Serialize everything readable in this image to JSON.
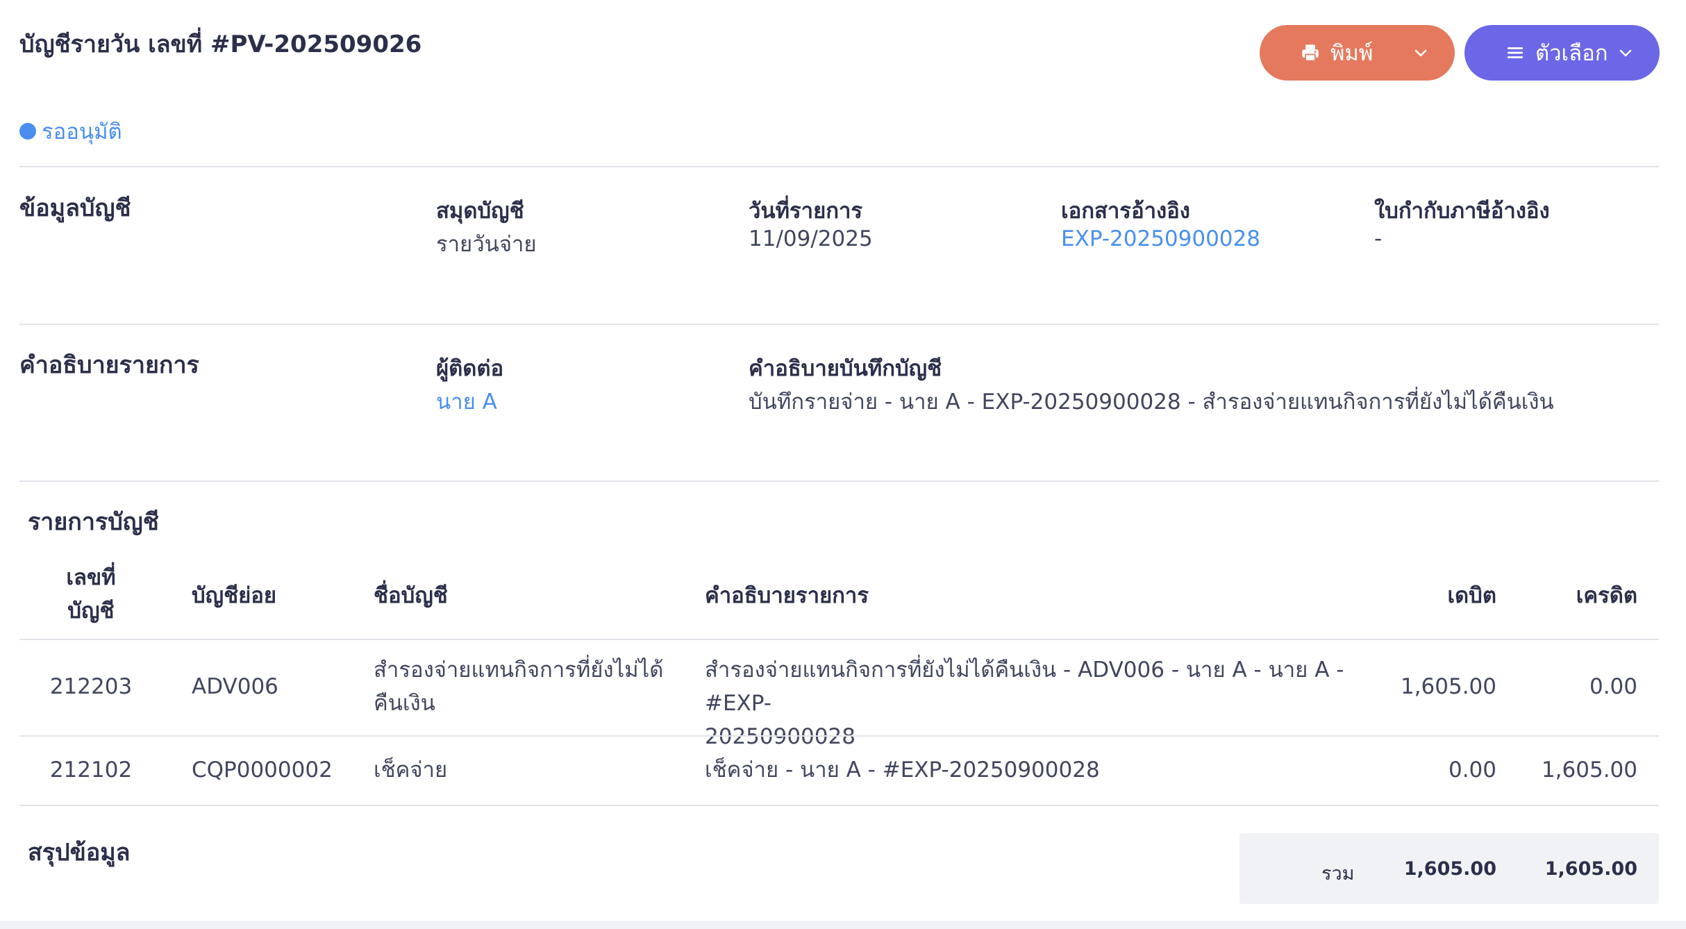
{
  "header": {
    "title": "บัญชีรายวัน เลขที่ #PV-202509026",
    "status": "รออนุมัติ",
    "print_button": "พิมพ์",
    "options_button": "ตัวเลือก"
  },
  "account_info": {
    "section_title": "ข้อมูลบัญชี",
    "book_label": "สมุดบัญชี",
    "book_value": "รายวันจ่าย",
    "date_label": "วันที่รายการ",
    "date_value": "11/09/2025",
    "ref_doc_label": "เอกสารอ้างอิง",
    "ref_doc_value": "EXP-20250900028",
    "tax_invoice_label": "ใบกำกับภาษีอ้างอิง",
    "tax_invoice_value": "-"
  },
  "description": {
    "section_title": "คำอธิบายรายการ",
    "contact_label": "ผู้ติดต่อ",
    "contact_value": "นาย A",
    "memo_label": "คำอธิบายบันทึกบัญชี",
    "memo_value": "บันทึกรายจ่าย - นาย A - EXP-20250900028 - สำรองจ่ายแทนกิจการที่ยังไม่ได้คืนเงิน"
  },
  "entries": {
    "section_title": "รายการบัญชี",
    "columns": {
      "account_no_line1": "เลขที่",
      "account_no_line2": "บัญชี",
      "sub_account": "บัญชีย่อย",
      "account_name": "ชื่อบัญชี",
      "description": "คำอธิบายรายการ",
      "debit": "เดบิต",
      "credit": "เครดิต"
    },
    "rows": [
      {
        "account_no": "212203",
        "sub_account": "ADV006",
        "account_name_line1": "สำรองจ่ายแทนกิจการที่ยังไม่ได้",
        "account_name_line2": "คืนเงิน",
        "description_line1": "สำรองจ่ายแทนกิจการที่ยังไม่ได้คืนเงิน - ADV006 - นาย A - นาย A - #EXP-",
        "description_line2": "20250900028",
        "debit": "1,605.00",
        "credit": "0.00"
      },
      {
        "account_no": "212102",
        "sub_account": "CQP0000002",
        "account_name_line1": "เช็คจ่าย",
        "description_line1": "เช็คจ่าย - นาย A - #EXP-20250900028",
        "debit": "0.00",
        "credit": "1,605.00"
      }
    ]
  },
  "summary": {
    "section_title": "สรุปข้อมูล",
    "total_label": "รวม",
    "total_debit": "1,605.00",
    "total_credit": "1,605.00"
  },
  "colors": {
    "print_button": "#e5795e",
    "options_button": "#6c67e6",
    "link": "#4a8ff0"
  },
  "icons": {
    "print": "printer-icon",
    "options": "menu-icon",
    "dropdown": "chevron-down-icon"
  }
}
